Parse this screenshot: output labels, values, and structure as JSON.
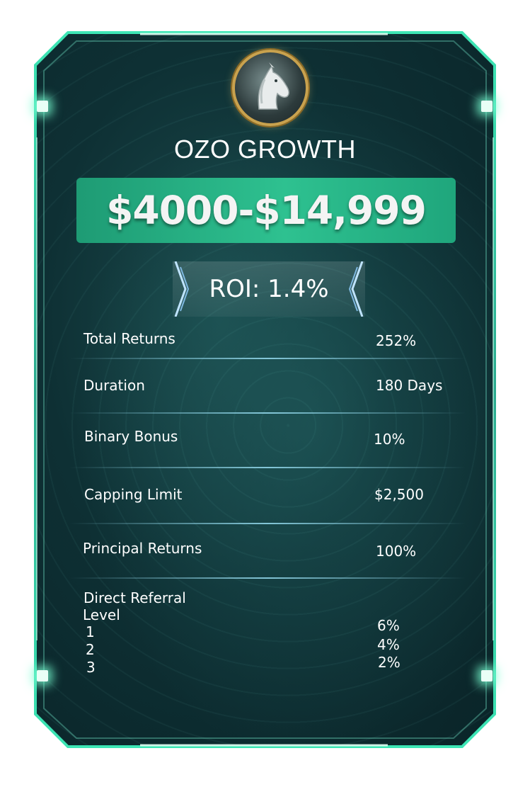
{
  "plan": {
    "name": "OZO GROWTH",
    "price_range": "$4000-$14,999",
    "roi": "ROI: 1.4%"
  },
  "rows": [
    {
      "label": "Total Returns",
      "value": "252%"
    },
    {
      "label": "Duration",
      "value": "180 Days"
    },
    {
      "label": "Binary Bonus",
      "value": "10%"
    },
    {
      "label": "Capping Limit",
      "value": "$2,500"
    },
    {
      "label": "Principal Returns",
      "value": "100%"
    }
  ],
  "referral": {
    "title": "Direct Referral",
    "level_header": "Level",
    "levels": [
      {
        "level": "1",
        "value": "6%"
      },
      {
        "level": "2",
        "value": "4%"
      },
      {
        "level": "3",
        "value": "2%"
      }
    ]
  },
  "icons": {
    "logo": "horse-head-icon"
  },
  "colors": {
    "accent": "#2ec190",
    "frame_glow": "#6fffd0",
    "background": "#0e3034"
  }
}
